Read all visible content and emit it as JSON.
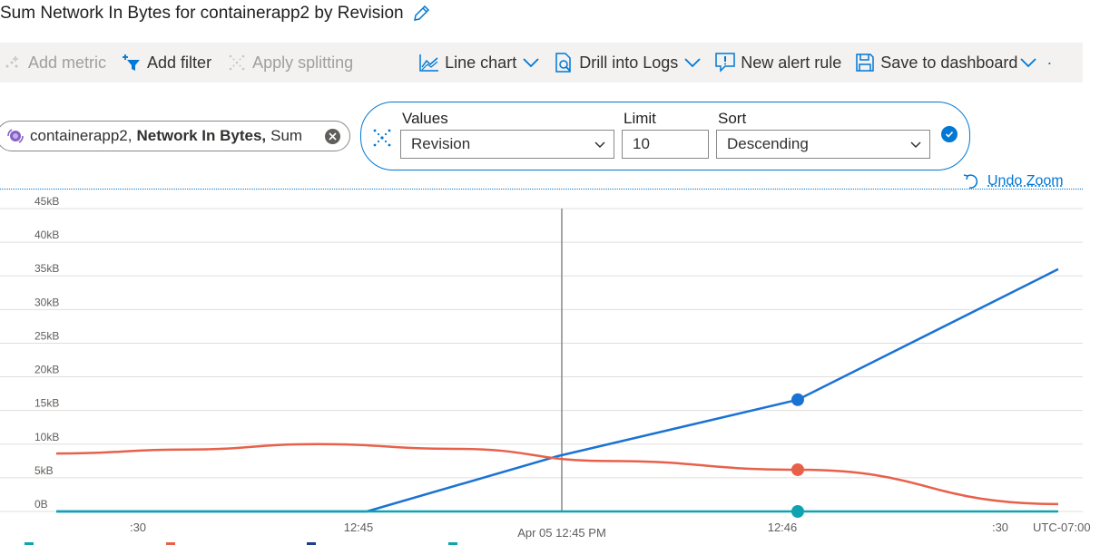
{
  "header": {
    "title": "Sum Network In Bytes for containerapp2 by Revision"
  },
  "toolbar": {
    "add_metric": "Add metric",
    "add_filter": "Add filter",
    "apply_splitting": "Apply splitting",
    "line_chart": "Line chart",
    "drill_into_logs": "Drill into Logs",
    "new_alert_rule": "New alert rule",
    "save_to_dashboard": "Save to dashboard",
    "more": "·"
  },
  "metric_pill": {
    "resource": "containerapp2,",
    "metric": "Network In Bytes,",
    "aggregation": "Sum"
  },
  "splitting": {
    "values_label": "Values",
    "values_selected": "Revision",
    "limit_label": "Limit",
    "limit_value": "10",
    "sort_label": "Sort",
    "sort_selected": "Descending"
  },
  "undo_zoom": "Undo Zoom",
  "colors": {
    "accent": "#0078d4",
    "series_blue": "#1a73d2",
    "series_red": "#e8604a",
    "series_teal": "#0fa3b1"
  },
  "chart_data": {
    "type": "line",
    "y_tick_labels": [
      "0B",
      "5kB",
      "10kB",
      "15kB",
      "20kB",
      "25kB",
      "30kB",
      "35kB",
      "40kB",
      "45kB"
    ],
    "ylim": [
      0,
      45
    ],
    "y_unit": "kB",
    "x_tick_labels": [
      ":30",
      "12:45",
      "12:46",
      ":30"
    ],
    "timezone_label": "UTC-07:00",
    "cursor_label": "Apr 05 12:45 PM",
    "series": [
      {
        "color": "#1a73d2",
        "values": [
          [
            0,
            0
          ],
          [
            0.31,
            0
          ],
          [
            0.5,
            8.2
          ],
          [
            0.74,
            16.6
          ],
          [
            1.0,
            36
          ]
        ]
      },
      {
        "color": "#e8604a",
        "values": [
          [
            0,
            8.6
          ],
          [
            0.13,
            9.2
          ],
          [
            0.26,
            10
          ],
          [
            0.4,
            9.3
          ],
          [
            0.55,
            7.5
          ],
          [
            0.74,
            6.2
          ],
          [
            1.0,
            1.1
          ]
        ]
      },
      {
        "color": "#0fa3b1",
        "values": [
          [
            0,
            0
          ],
          [
            1.0,
            0
          ]
        ]
      }
    ],
    "hover_index_x": 0.74
  }
}
